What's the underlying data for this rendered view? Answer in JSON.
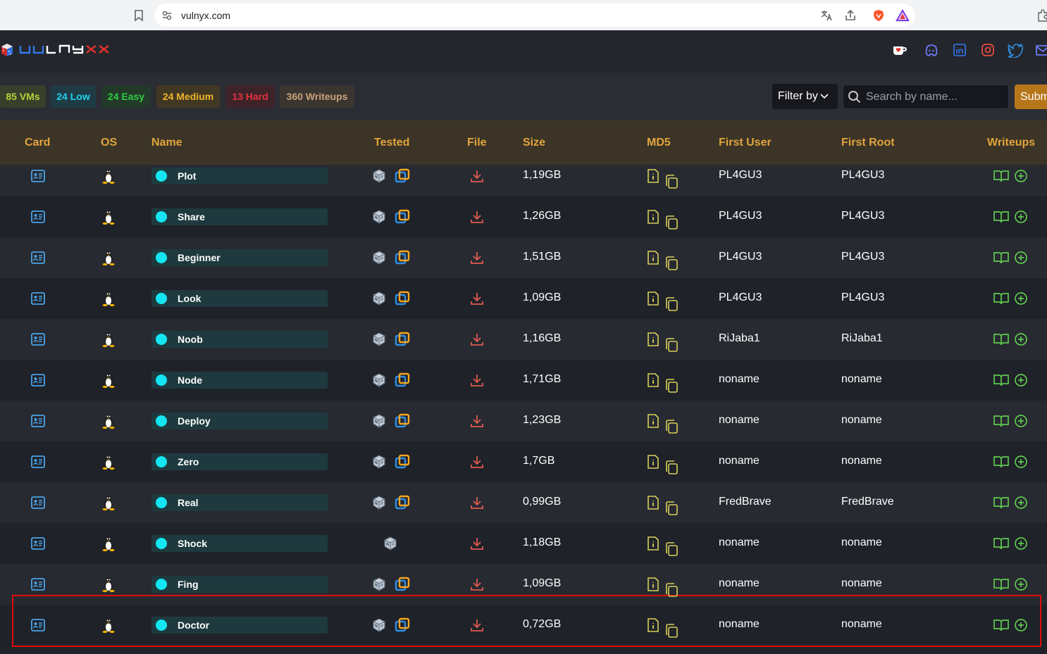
{
  "browser": {
    "url": "vulnyx.com"
  },
  "header": {
    "logo_text": "VULNYX",
    "social_icons": [
      "kofi-icon",
      "discord-icon",
      "linkedin-icon",
      "instagram-icon",
      "twitter-icon",
      "mail-icon"
    ]
  },
  "stats": {
    "vms": "85 VMs",
    "low": "24 Low",
    "easy": "24 Easy",
    "medium": "24 Medium",
    "hard": "13 Hard",
    "writeups": "360 Writeups"
  },
  "filter": {
    "label": "Filter by",
    "search_placeholder": "Search by name...",
    "submit_label": "Subm"
  },
  "table": {
    "headers": {
      "card": "Card",
      "os": "OS",
      "name": "Name",
      "tested": "Tested",
      "file": "File",
      "size": "Size",
      "md5": "MD5",
      "first_user": "First User",
      "first_root": "First Root",
      "writeups": "Writeups"
    },
    "rows": [
      {
        "name": "Plot",
        "size": "1,19GB",
        "first_user": "PL4GU3",
        "first_root": "PL4GU3",
        "tested": [
          "virtualbox",
          "vmware"
        ]
      },
      {
        "name": "Share",
        "size": "1,26GB",
        "first_user": "PL4GU3",
        "first_root": "PL4GU3",
        "tested": [
          "virtualbox",
          "vmware"
        ]
      },
      {
        "name": "Beginner",
        "size": "1,51GB",
        "first_user": "PL4GU3",
        "first_root": "PL4GU3",
        "tested": [
          "virtualbox",
          "vmware"
        ]
      },
      {
        "name": "Look",
        "size": "1,09GB",
        "first_user": "PL4GU3",
        "first_root": "PL4GU3",
        "tested": [
          "virtualbox",
          "vmware"
        ]
      },
      {
        "name": "Noob",
        "size": "1,16GB",
        "first_user": "RiJaba1",
        "first_root": "RiJaba1",
        "tested": [
          "virtualbox",
          "vmware"
        ]
      },
      {
        "name": "Node",
        "size": "1,71GB",
        "first_user": "noname",
        "first_root": "noname",
        "tested": [
          "virtualbox",
          "vmware"
        ]
      },
      {
        "name": "Deploy",
        "size": "1,23GB",
        "first_user": "noname",
        "first_root": "noname",
        "tested": [
          "virtualbox",
          "vmware"
        ]
      },
      {
        "name": "Zero",
        "size": "1,7GB",
        "first_user": "noname",
        "first_root": "noname",
        "tested": [
          "virtualbox",
          "vmware"
        ]
      },
      {
        "name": "Real",
        "size": "0,99GB",
        "first_user": "FredBrave",
        "first_root": "FredBrave",
        "tested": [
          "virtualbox",
          "vmware"
        ]
      },
      {
        "name": "Shock",
        "size": "1,18GB",
        "first_user": "noname",
        "first_root": "noname",
        "tested": [
          "virtualbox"
        ]
      },
      {
        "name": "Fing",
        "size": "1,09GB",
        "first_user": "noname",
        "first_root": "noname",
        "tested": [
          "virtualbox",
          "vmware"
        ]
      },
      {
        "name": "Doctor",
        "size": "0,72GB",
        "first_user": "noname",
        "first_root": "noname",
        "tested": [
          "virtualbox",
          "vmware"
        ]
      }
    ]
  },
  "colors": {
    "header_text": "#e3a43c",
    "name_dot": "#13e6f2",
    "download": "#e05a4f",
    "md5": "#d9cf5a",
    "writeups": "#5fc94f",
    "highlight": "#e00b0b"
  }
}
